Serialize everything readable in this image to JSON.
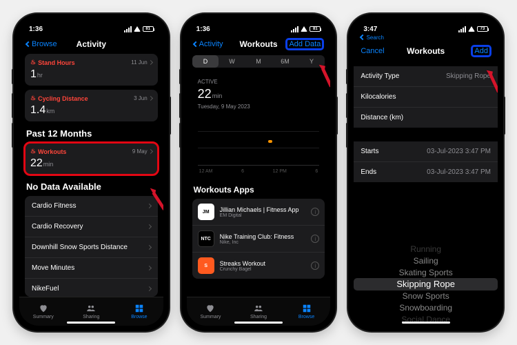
{
  "status": {
    "time1": "1:36",
    "time2": "1:36",
    "time3": "3:47",
    "battery1": "81",
    "battery3": "73",
    "search_back": "Search"
  },
  "screen1": {
    "back_label": "Browse",
    "title": "Activity",
    "card1_title": "Stand Hours",
    "card1_date": "11 Jun",
    "card1_value": "1",
    "card1_unit": "hr",
    "card2_title": "Cycling Distance",
    "card2_date": "3 Jun",
    "card2_value": "1.4",
    "card2_unit": "km",
    "section1": "Past 12 Months",
    "card3_title": "Workouts",
    "card3_date": "9 May",
    "card3_value": "22",
    "card3_unit": "min",
    "section2": "No Data Available",
    "rows": [
      "Cardio Fitness",
      "Cardio Recovery",
      "Downhill Snow Sports Distance",
      "Move Minutes",
      "NikeFuel"
    ]
  },
  "screen2": {
    "back_label": "Activity",
    "title": "Workouts",
    "right_label": "Add Data",
    "seg": [
      "D",
      "W",
      "M",
      "6M",
      "Y"
    ],
    "active_label": "ACTIVE",
    "value": "22",
    "unit": "min",
    "date": "Tuesday, 9 May 2023",
    "axis": [
      "12 AM",
      "6",
      "12 PM",
      "6"
    ],
    "apps_header": "Workouts Apps",
    "apps": [
      {
        "name": "Jillian Michaels | Fitness App",
        "pub": "EM Digital",
        "bg": "#fff",
        "fg": "#000",
        "abbr": "JM"
      },
      {
        "name": "Nike Training Club: Fitness",
        "pub": "Nike, Inc",
        "bg": "#000",
        "fg": "#fff",
        "abbr": "NTC"
      },
      {
        "name": "Streaks Workout",
        "pub": "Crunchy Bagel",
        "bg": "#ff5a1f",
        "fg": "#fff",
        "abbr": "S"
      }
    ]
  },
  "screen3": {
    "left_label": "Cancel",
    "title": "Workouts",
    "right_label": "Add",
    "field_activity": "Activity Type",
    "value_activity": "Skipping Rope",
    "field_kcal": "Kilocalories",
    "field_dist": "Distance (km)",
    "field_starts": "Starts",
    "value_starts": "03-Jul-2023  3:47 PM",
    "field_ends": "Ends",
    "value_ends": "03-Jul-2023  3:47 PM",
    "picker": [
      "Running",
      "Sailing",
      "Skating Sports",
      "Skipping Rope",
      "Snow Sports",
      "Snowboarding",
      "Social Dance"
    ]
  },
  "tabs": {
    "summary": "Summary",
    "sharing": "Sharing",
    "browse": "Browse"
  },
  "chart_data": {
    "type": "bar",
    "title": "Workouts",
    "metric": "ACTIVE",
    "unit": "min",
    "date": "Tuesday, 9 May 2023",
    "segment": "D",
    "x_categories": [
      "12 AM",
      "6",
      "12 PM",
      "6"
    ],
    "values": [
      0,
      0,
      22,
      0
    ],
    "ylim": [
      0,
      30
    ]
  }
}
